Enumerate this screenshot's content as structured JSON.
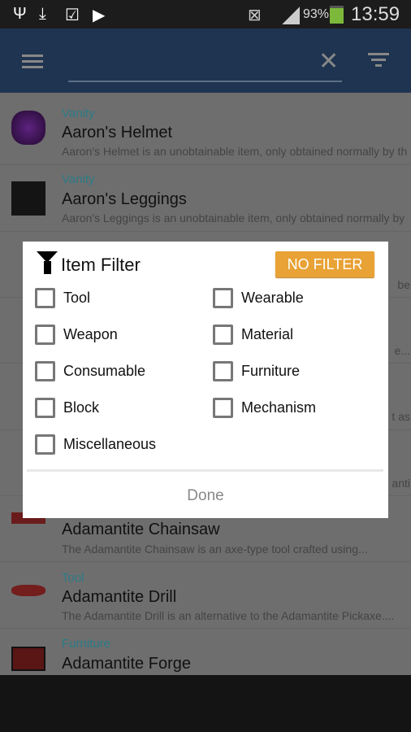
{
  "status_bar": {
    "battery": "93%",
    "time": "13:59",
    "icons": [
      "usb-icon",
      "download-icon",
      "clipboard-check-icon",
      "clipboard-play-icon",
      "nfc-off-icon",
      "signal-icon",
      "battery-charging-icon"
    ]
  },
  "app_bar": {
    "search_value": "",
    "icons": [
      "menu-icon",
      "clear-icon",
      "filter-icon"
    ]
  },
  "list": [
    {
      "category": "Vanity",
      "title": "Aaron's Helmet",
      "desc": "Aaron's Helmet is an unobtainable item, only obtained normally by th"
    },
    {
      "category": "Vanity",
      "title": "Aaron's Leggings",
      "desc": "Aaron's Leggings is an unobtainable item, only obtained normally by"
    },
    {
      "fragment": "be"
    },
    {
      "fragment": "e..."
    },
    {
      "fragment": "t as"
    },
    {
      "fragment": "anti"
    },
    {
      "category": "",
      "title": "Adamantite Chainsaw",
      "desc": "The Adamantite Chainsaw is an axe-type tool crafted using..."
    },
    {
      "category": "Tool",
      "title": "Adamantite Drill",
      "desc": "The Adamantite Drill is an alternative to the Adamantite Pickaxe...."
    },
    {
      "category": "Furniture",
      "title": "Adamantite Forge",
      "desc": ""
    }
  ],
  "dialog": {
    "title": "Item Filter",
    "no_filter": "NO FILTER",
    "options": [
      "Tool",
      "Wearable",
      "Weapon",
      "Material",
      "Consumable",
      "Furniture",
      "Block",
      "Mechanism",
      "Miscellaneous"
    ],
    "done": "Done"
  },
  "colors": {
    "app_bar": "#1f3450",
    "category": "#3aa6b8",
    "no_filter": "#e8a235"
  }
}
